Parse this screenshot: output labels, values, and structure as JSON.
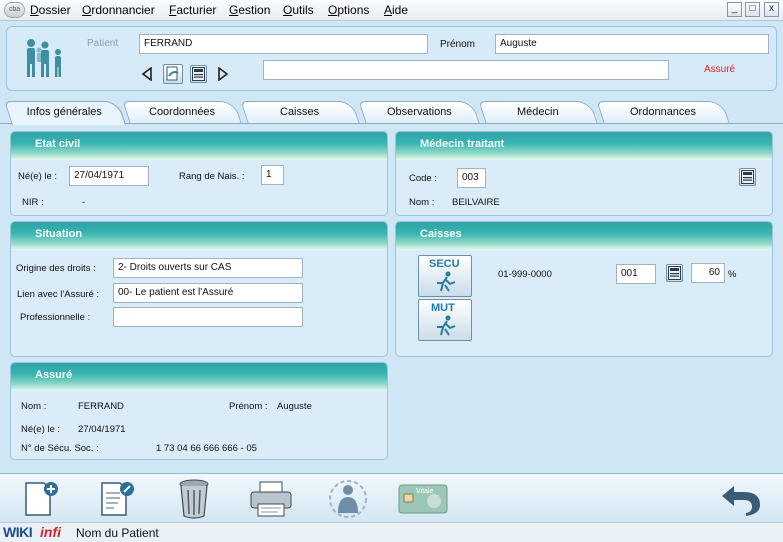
{
  "menu": [
    "Dossier",
    "Ordonnancier",
    "Facturier",
    "Gestion",
    "Outils",
    "Options",
    "Aide"
  ],
  "app_logo": "cba",
  "window_controls": [
    "_",
    "□",
    "x"
  ],
  "header": {
    "patient_label": "Patient",
    "patient_value": "FERRAND",
    "prenom_label": "Prénom",
    "prenom_value": "Auguste",
    "assure_label": "Assuré",
    "note_value": ""
  },
  "tabs": [
    "Infos générales",
    "Coordonnées",
    "Caisses",
    "Observations",
    "Médecin",
    "Ordonnances"
  ],
  "etat_civil": {
    "title": "Etat civil",
    "ne_le_label": "Né(e) le :",
    "ne_le_value": "27/04/1971",
    "rang_label": "Rang de Nais. :",
    "rang_value": "1",
    "nir_label": "NIR :",
    "nir_value": "-"
  },
  "medecin": {
    "title": "Médecin traitant",
    "code_label": "Code :",
    "code_value": "003",
    "nom_label": "Nom :",
    "nom_value": "BEILVAIRE"
  },
  "situation": {
    "title": "Situation",
    "origine_label": "Origine des droits :",
    "origine_value": "2- Droits ouverts sur CAS",
    "lien_label": "Lien avec l'Assuré :",
    "lien_value": "00- Le patient est l'Assuré",
    "pro_label": "Professionnelle :",
    "pro_value": ""
  },
  "caisses": {
    "title": "Caisses",
    "secu_label": "SECU",
    "mut_label": "MUT",
    "numero": "01-999-0000",
    "code_value": "001",
    "taux_value": "60",
    "pct": "%"
  },
  "assure": {
    "title": "Assuré",
    "nom_label": "Nom :",
    "nom_value": "FERRAND",
    "prenom_label": "Prénom :",
    "prenom_value": "Auguste",
    "ne_le_label": "Né(e) le :",
    "ne_le_value": "27/04/1971",
    "secu_label": "N° de Sécu. Soc. :",
    "secu_value": "1 73 04 66 666 666 - 05"
  },
  "status": {
    "brand_wiki": "WIKI",
    "brand_infi": "infi",
    "text": "Nom du Patient"
  },
  "vitale_text": "Vitale"
}
